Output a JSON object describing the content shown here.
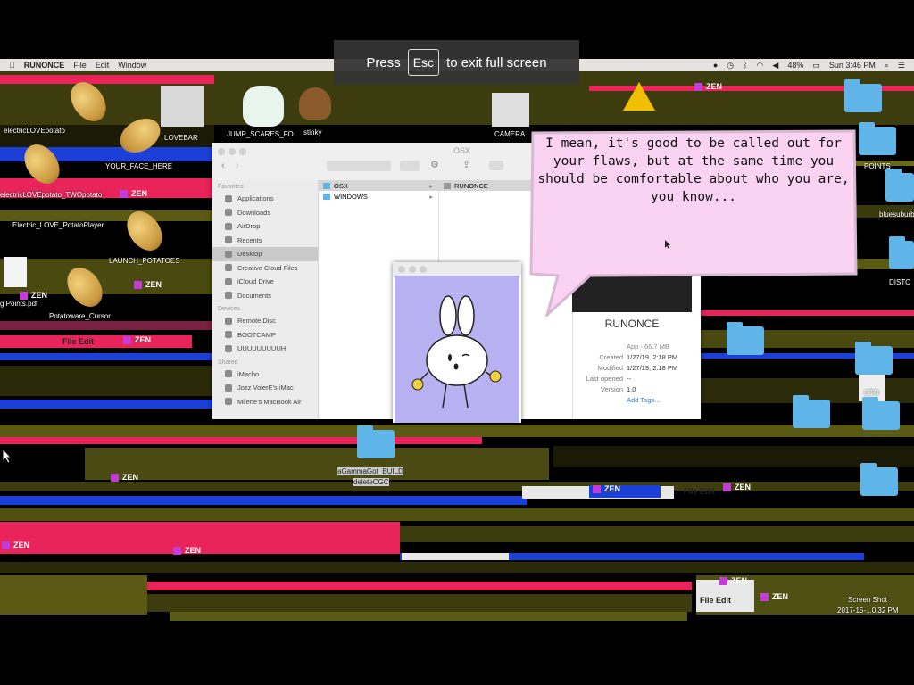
{
  "fullscreen_hint": {
    "press": "Press",
    "key": "Esc",
    "rest": "to exit full screen"
  },
  "menubar": {
    "app_name": "RUNONCE",
    "menus": [
      "File",
      "Edit",
      "Window"
    ],
    "battery": "48%",
    "clock": "Sun 3:46 PM"
  },
  "desktop_labels": {
    "electric_love_potato": "electricLOVEpotato",
    "lovebar": "LOVEBAR",
    "jump_scares": "JUMP_SCARES_FO",
    "stinky": "stinky",
    "camera": "CAMERA",
    "your_face_here": "YOUR_FACE_HERE",
    "electric_love_two": "electricLOVEpotato_TWOpotato",
    "electric_love_pot": "Electric_LOVE_PotatoPlayer",
    "launch_potatoes": "LAUNCH_POTATOES",
    "points_pdf": "g Points.pdf",
    "potatoware_cursor": "Potatoware_Cursor",
    "points": "POINTS",
    "bluesuburbs": "bluesuburbs",
    "disto": "DISTO",
    "cto": "CTO",
    "screen_shot": "Screen Shot",
    "screen_shot_date": "2017-15-...0.32 PM",
    "folder_under": "aGammaGot_BUILD",
    "folder_under2": "deleteCGC",
    "zen": "ZEN",
    "file_edit": "File  Edit"
  },
  "finder": {
    "title": "OSX",
    "sidebar": {
      "favorites_header": "Favorites",
      "favorites": [
        "Applications",
        "Downloads",
        "AirDrop",
        "Recents",
        "Desktop",
        "Creative Cloud Files",
        "iCloud Drive",
        "Documents"
      ],
      "devices_header": "Devices",
      "devices": [
        "Remote Disc",
        "BOOTCAMP",
        "UUUUUUUUUH"
      ],
      "shared_header": "Shared",
      "shared": [
        "iMacho",
        "Jozz VolerE's iMac",
        "Milene's MacBook Air"
      ]
    },
    "column1": [
      "OSX",
      "WINDOWS"
    ],
    "column2": [
      "RUNONCE"
    ],
    "preview": {
      "name": "RUNONCE",
      "kind": "App - 66.7 MB",
      "rows": [
        {
          "k": "Created",
          "v": "1/27/19, 2:18 PM"
        },
        {
          "k": "Modified",
          "v": "1/27/19, 2:18 PM"
        },
        {
          "k": "Last opened",
          "v": "--"
        },
        {
          "k": "Version",
          "v": "1.0"
        }
      ],
      "add_tags": "Add Tags..."
    }
  },
  "bubble": {
    "text": "I mean, it's good to be called out for your flaws, but at the same time you should be comfortable about who you are, you know..."
  },
  "colors": {
    "glitch_pink": "#e8245a",
    "glitch_olive": "#5a5a14",
    "glitch_blue": "#1c3fd8",
    "bubble": "#fad3f3",
    "bunny_bg": "#b8b2f2"
  }
}
